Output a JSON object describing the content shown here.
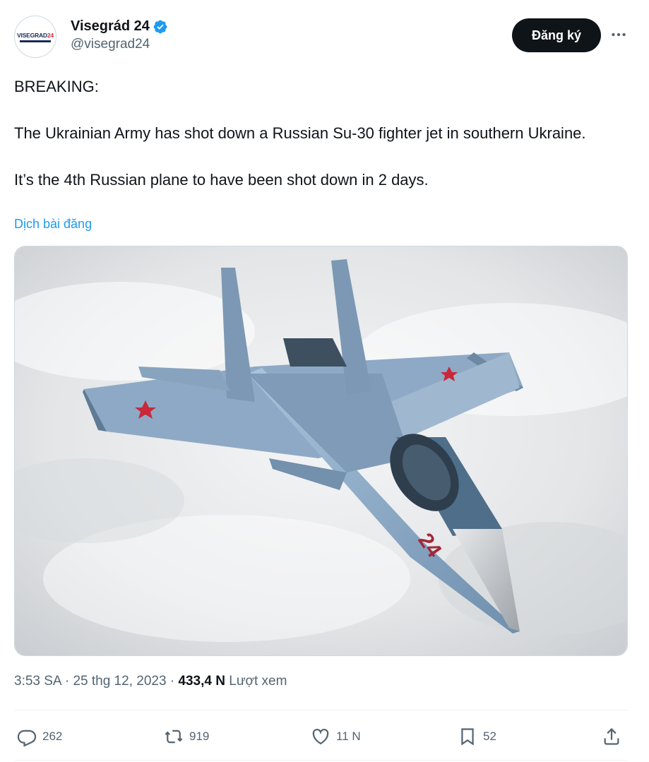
{
  "account": {
    "display_name": "Visegrád 24",
    "handle": "@visegrad24",
    "avatar_text": "VISEGRAD",
    "avatar_number": "24"
  },
  "follow_button": "Đăng ký",
  "tweet": {
    "paragraphs": [
      "BREAKING:",
      "The Ukrainian Army has shot down a Russian Su-30 fighter jet in southern Ukraine.",
      "It’s the 4th Russian plane to have been shot down in 2 days."
    ],
    "translate_link": "Dịch bài đăng"
  },
  "meta": {
    "time": "3:53 SA",
    "date": "25 thg 12, 2023",
    "views_count": "433,4 N",
    "views_label": "Lượt xem"
  },
  "actions": {
    "replies": "262",
    "reposts": "919",
    "likes": "11 N",
    "bookmarks": "52"
  },
  "colors": {
    "link": "#1d9bf0",
    "verified": "#1d9bf0",
    "muted": "#536471",
    "button_bg": "#0f1419"
  },
  "image": {
    "tail_number": "24"
  }
}
